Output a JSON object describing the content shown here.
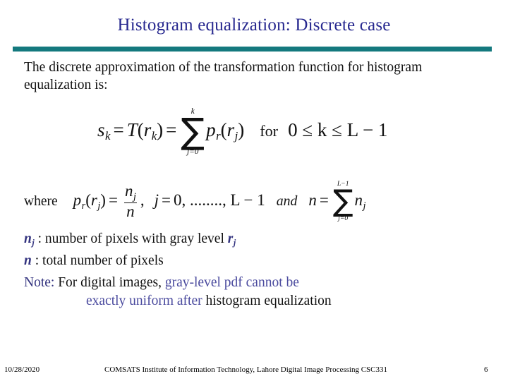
{
  "slide": {
    "title": "Histogram equalization: Discrete case",
    "accent_rule_color": "#14797e",
    "title_color": "#27288f",
    "symbol_color": "#33337f",
    "note_accent_color": "#4a4a9e",
    "intro_paragraph": "The discrete approximation of the transformation function for histogram equalization is:"
  },
  "equation_main": {
    "lhs_s": "s",
    "lhs_s_sub": "k",
    "eq1": "=",
    "T": "T",
    "open_paren": "(",
    "r": "r",
    "r_sub": "k",
    "close_paren": ")",
    "eq2": "=",
    "sum_upper": "k",
    "sum_symbol": "∑",
    "sum_lower": "j=0",
    "p": "p",
    "p_sub": "r",
    "open_paren2": "(",
    "rj": "r",
    "rj_sub": "j",
    "close_paren2": ")",
    "for_word": "for",
    "range": "0 ≤ k ≤ L − 1",
    "plain_text": "s_k = T(r_k) = sum_{j=0}^{k} p_r(r_j)   for   0 <= k <= L-1"
  },
  "equation_where": {
    "where_label": "where",
    "p": "p",
    "p_sub": "r",
    "open_paren": "(",
    "r": "r",
    "r_sub": "j",
    "close_paren": ")",
    "equals": "=",
    "frac_num": "n",
    "frac_num_sub": "j",
    "frac_den": "n",
    "comma": ",",
    "index_var": "j",
    "index_equals": "=",
    "index_range": "0, ........, L − 1",
    "and_word": "and",
    "n_var": "n",
    "n_equals": "=",
    "sum_upper": "L−1",
    "sum_symbol": "∑",
    "sum_lower": "j=0",
    "sum_term": "n",
    "sum_term_sub": "j",
    "plain_text": "p_r(r_j) = n_j / n ,  j = 0,........,L-1  and  n = sum_{j=0}^{L-1} n_j"
  },
  "definitions": [
    {
      "symbol": "n",
      "symbol_sub": "j",
      "separator": " : ",
      "text_before": "number of pixels with gray level ",
      "trailing_symbol": "r",
      "trailing_symbol_sub": "j"
    },
    {
      "symbol": "n",
      "symbol_sub": "",
      "separator": "  : ",
      "text_before": "total number of pixels",
      "trailing_symbol": "",
      "trailing_symbol_sub": ""
    }
  ],
  "note": {
    "label": "Note:",
    "part_black_1": " For digital images,",
    "part_accent_1": " gray-level pdf cannot be",
    "part_accent_2": "exactly uniform after ",
    "part_black_2": "histogram equalization",
    "full_text": "Note: For digital images, gray-level pdf cannot be exactly uniform after histogram equalization"
  },
  "footer": {
    "date": "10/28/2020",
    "center": "COMSATS Institute of Information Technology, Lahore  Digital Image Processing CSC331",
    "page_number": "6"
  }
}
